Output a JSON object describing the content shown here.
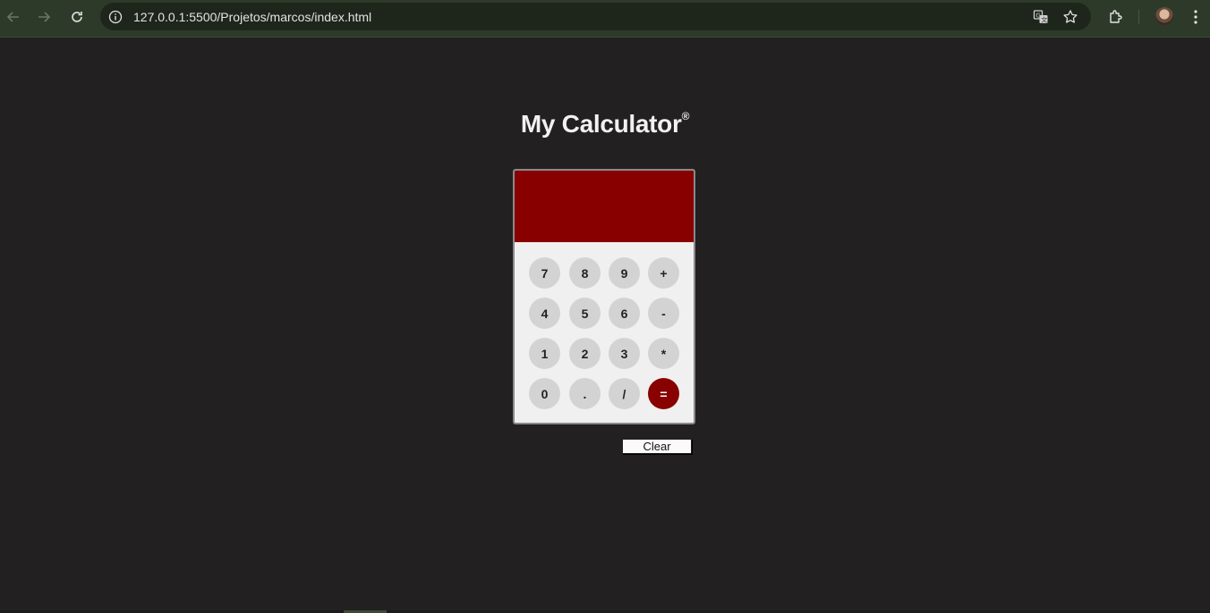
{
  "browser": {
    "url": "127.0.0.1:5500/Projetos/marcos/index.html",
    "icons": [
      "back-arrow-icon",
      "forward-arrow-icon",
      "reload-icon",
      "info-icon",
      "translate-icon",
      "star-icon",
      "extensions-icon",
      "profile-avatar",
      "kebab-menu-icon"
    ],
    "colors": {
      "toolbar": "#2d3a2a",
      "omnibox": "#1e261c"
    }
  },
  "page": {
    "title": "My Calculator",
    "title_mark": "®",
    "background": "#222021"
  },
  "calculator": {
    "display_value": "",
    "display_color": "#880000",
    "keys": [
      [
        "7",
        "8",
        "9",
        "+"
      ],
      [
        "4",
        "5",
        "6",
        "-"
      ],
      [
        "1",
        "2",
        "3",
        "*"
      ],
      [
        "0",
        ".",
        "/",
        "="
      ]
    ],
    "clear_label": "Clear"
  }
}
